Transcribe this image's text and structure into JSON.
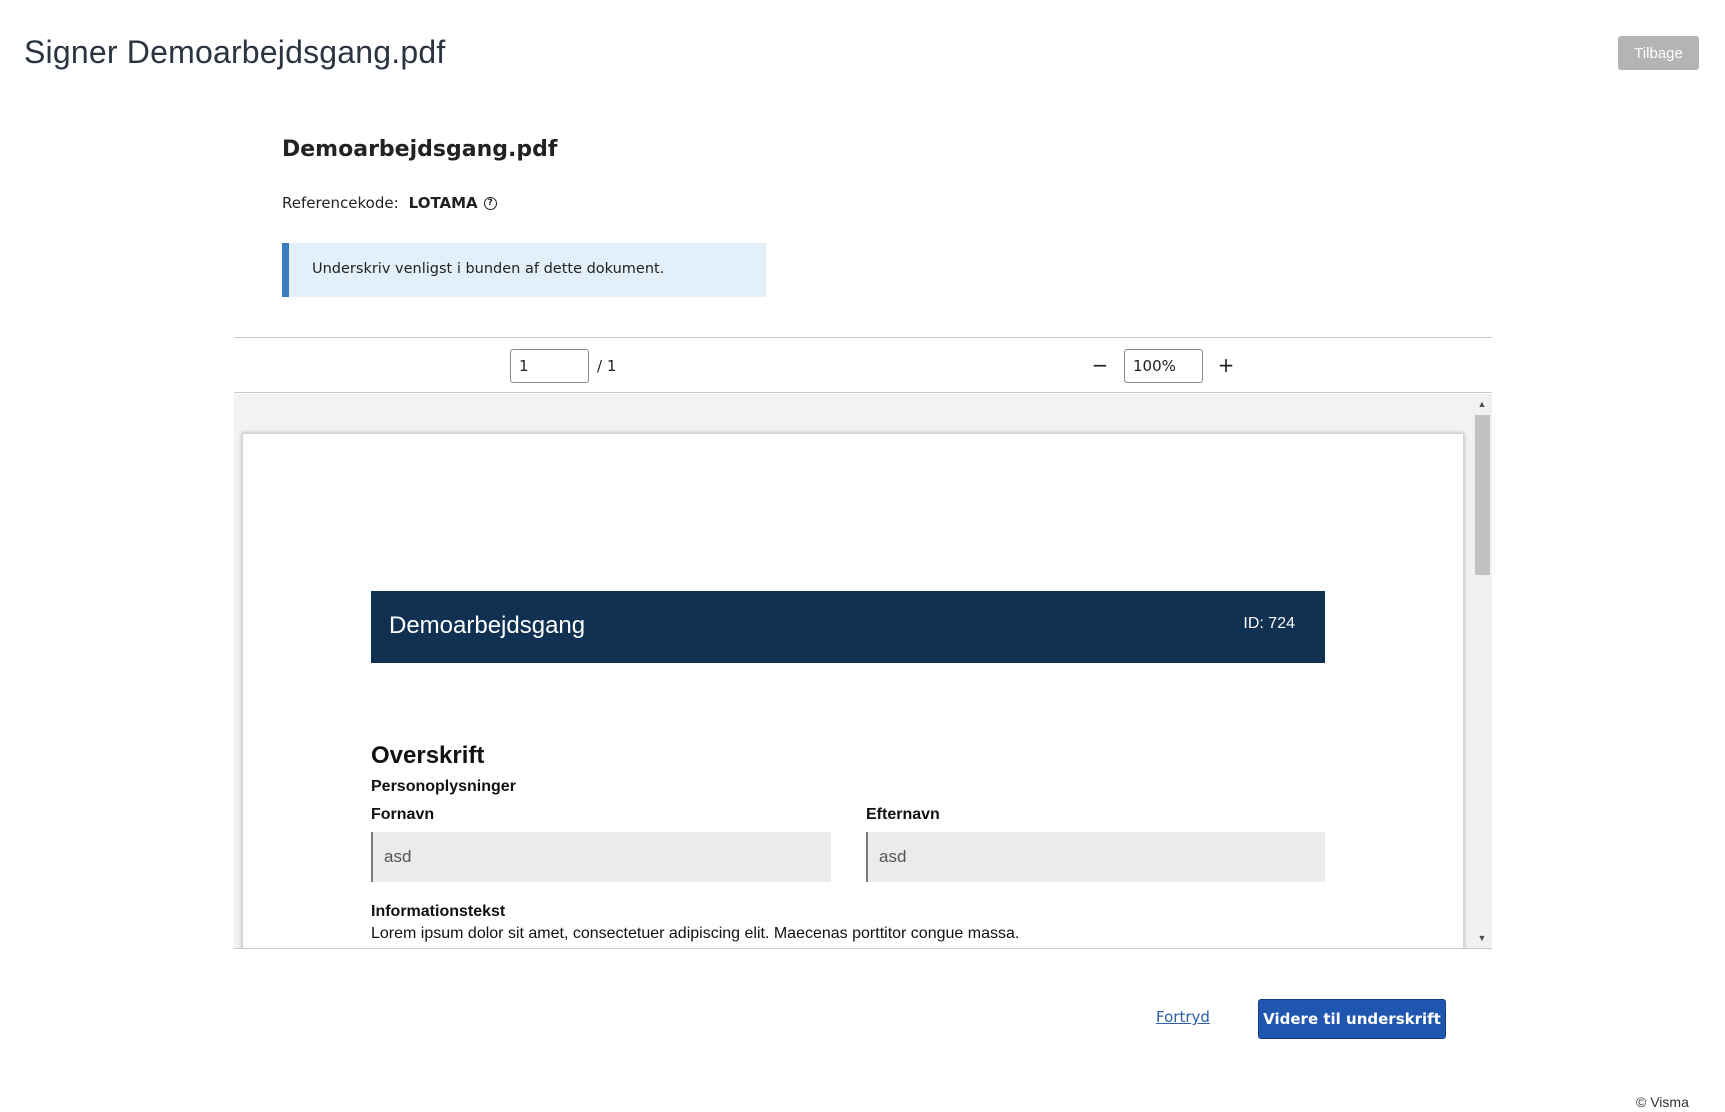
{
  "header": {
    "title": "Signer Demoarbejdsgang.pdf",
    "back_label": "Tilbage"
  },
  "document": {
    "name": "Demoarbejdsgang.pdf",
    "reference_label": "Referencekode:",
    "reference_code": "LOTAMA",
    "help_icon": "question-circle-icon",
    "notice": "Underskriv venligst i bunden af dette dokument."
  },
  "toolbar": {
    "page_value": "1",
    "page_total": "/ 1",
    "zoom_out_label": "−",
    "zoom_value": "100%",
    "zoom_in_label": "+"
  },
  "pdf": {
    "form_title": "Demoarbejdsgang",
    "form_id": "ID: 724",
    "section_title": "Overskrift",
    "subsection_title": "Personoplysninger",
    "first_name_label": "Fornavn",
    "first_name_value": "asd",
    "last_name_label": "Efternavn",
    "last_name_value": "asd",
    "info_heading": "Informationstekst",
    "info_body": "Lorem ipsum dolor sit amet, consectetuer adipiscing elit. Maecenas porttitor congue massa."
  },
  "actions": {
    "cancel_label": "Fortryd",
    "continue_label": "Videre til underskrift"
  },
  "footer": {
    "copyright": "© Visma"
  },
  "colors": {
    "form_header": "#113153",
    "primary_button": "#1f56b0",
    "notice_background": "#e3eff9",
    "notice_accent": "#3a7cc0",
    "back_button": "#b4b4b4"
  }
}
